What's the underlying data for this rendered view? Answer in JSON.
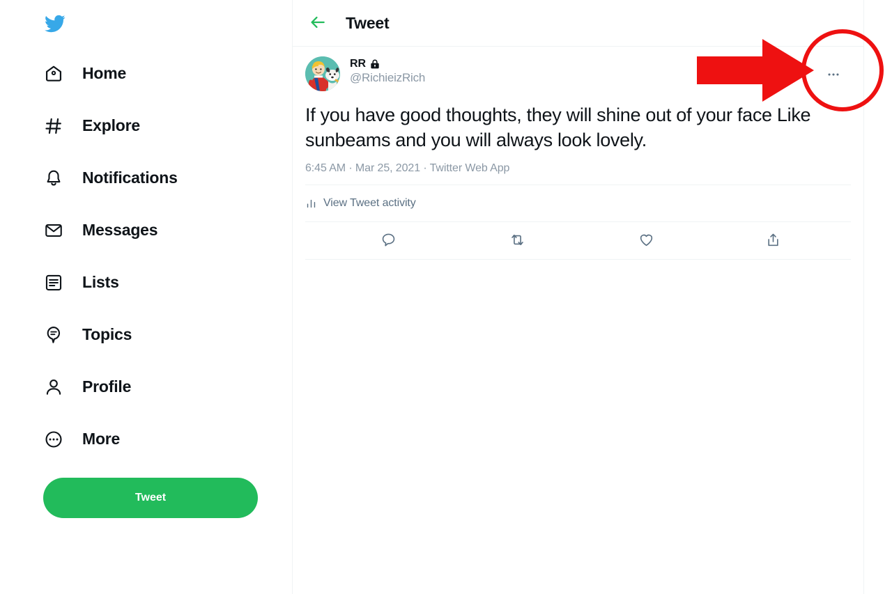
{
  "app": {
    "name": "Twitter",
    "logo_icon": "twitter-bird-icon",
    "accent_green": "#22bb5b",
    "brand_blue": "#1d9bf0",
    "text_primary": "#0f1419",
    "text_muted": "#8b98a5",
    "border": "#eff3f4",
    "annotation_red": "#ee1111"
  },
  "sidebar": {
    "items": [
      {
        "label": "Home",
        "icon": "home-icon"
      },
      {
        "label": "Explore",
        "icon": "hashtag-icon"
      },
      {
        "label": "Notifications",
        "icon": "bell-icon"
      },
      {
        "label": "Messages",
        "icon": "envelope-icon"
      },
      {
        "label": "Lists",
        "icon": "list-icon"
      },
      {
        "label": "Topics",
        "icon": "topics-balloon-icon"
      },
      {
        "label": "Profile",
        "icon": "person-icon"
      },
      {
        "label": "More",
        "icon": "more-circle-icon"
      }
    ],
    "tweet_button": {
      "label": "Tweet"
    }
  },
  "main": {
    "header": {
      "title": "Tweet",
      "back_icon": "back-arrow-icon"
    },
    "tweet": {
      "author": {
        "name": "RR",
        "handle": "@RichieizRich",
        "protected_badge_icon": "lock-icon",
        "avatar_icon": "avatar-cartoon-image"
      },
      "more_options_icon": "ellipsis-icon",
      "text": "If you have good thoughts, they will shine out of your face Like sunbeams and you will always look lovely.",
      "timestamp": "6:45 AM · Mar 25, 2021 · Twitter Web App",
      "activity": {
        "label": "View Tweet activity",
        "icon": "bar-chart-icon"
      },
      "actions": [
        {
          "name": "reply",
          "icon": "reply-icon"
        },
        {
          "name": "retweet",
          "icon": "retweet-icon"
        },
        {
          "name": "like",
          "icon": "heart-icon"
        },
        {
          "name": "share",
          "icon": "share-icon"
        }
      ]
    }
  },
  "annotation": {
    "arrow_icon": "red-arrow-icon",
    "circle_icon": "red-circle-highlight",
    "target": "ellipsis-icon"
  }
}
